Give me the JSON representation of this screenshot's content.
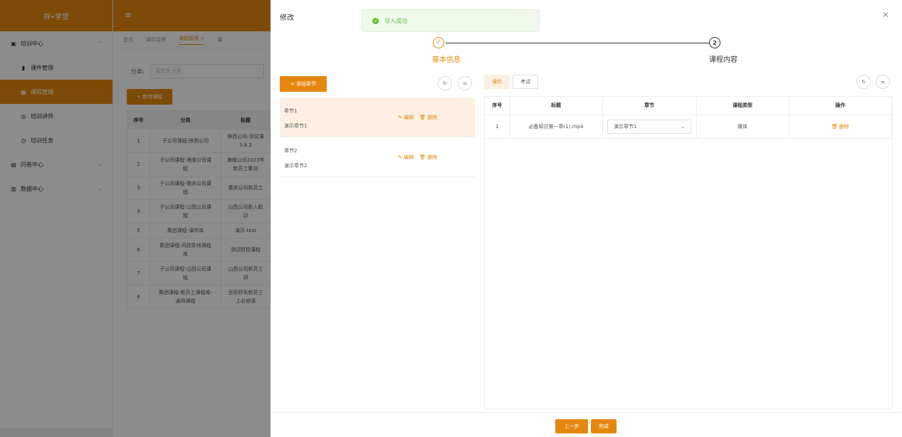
{
  "app": {
    "logo": "祥•学堂",
    "menu_icon": "hamburger-icon"
  },
  "sidebar": {
    "items": [
      {
        "label": "培训中心",
        "icon": "doc-icon",
        "chevron": "⌃"
      },
      {
        "label": "课件管理",
        "icon": "book-icon"
      },
      {
        "label": "课程管理",
        "icon": "grid-icon",
        "active": true
      },
      {
        "label": "培训讲师",
        "icon": "user-icon"
      },
      {
        "label": "培训任务",
        "icon": "clock-icon"
      },
      {
        "label": "问卷中心",
        "icon": "survey-icon",
        "chevron": "⌄"
      },
      {
        "label": "数据中心",
        "icon": "chart-icon",
        "chevron": "⌄"
      }
    ]
  },
  "tabs": [
    "首页",
    "课件管理",
    "课程管理 ×",
    "课"
  ],
  "filter": {
    "label": "分类:",
    "placeholder": "请选择 分类"
  },
  "new_course_button": "+ 新增课程",
  "bg_table": {
    "headers": [
      "序号",
      "分类",
      "标题"
    ],
    "rows": [
      [
        "1",
        "子公司课程-陕西公司",
        "陕西公司-测试课\n3.8.2"
      ],
      [
        "2",
        "子公司课程-海南公司课\n程",
        "海南公司2023年\n新员工集训"
      ],
      [
        "3",
        "子公司课程-重庆公司课\n程",
        "重庆公司新员工"
      ],
      [
        "4",
        "子公司课程-山西公司课\n程",
        "山西公司新入职\n训"
      ],
      [
        "5",
        "集团课程-课件库",
        "演示-test"
      ],
      [
        "6",
        "集团课程-风控条线课程\n库",
        "测试财控课程"
      ],
      [
        "7",
        "子公司课程-山西公司课\n程",
        "山西公司新员工\n训"
      ],
      [
        "8",
        "集团课程-新员工课程库-\n通用课程",
        "豆形好车新员工\n上必修课"
      ]
    ]
  },
  "drawer": {
    "title": "修改",
    "toast": "导入成功",
    "steps": [
      {
        "label": "基本信息",
        "state": "done"
      },
      {
        "label": "课程内容",
        "number": "2",
        "state": "active"
      }
    ],
    "add_chapter_button": "+ 添加章节",
    "chapters": [
      {
        "code": "章节1",
        "name": "演示章节1",
        "edit": "编辑",
        "delete": "删除",
        "selected": true
      },
      {
        "code": "章节2",
        "name": "演示章节2",
        "edit": "编辑",
        "delete": "删除",
        "selected": false
      }
    ],
    "content_tabs": [
      "课件",
      "考试"
    ],
    "content_table": {
      "headers": [
        "序号",
        "标题",
        "章节",
        "课程类型",
        "操作"
      ],
      "rows": [
        {
          "index": "1",
          "title": "必备知识第一章(1).mp4",
          "chapter": "演示章节1",
          "type": "媒体",
          "action": "删除"
        }
      ]
    },
    "footer": {
      "prev": "上一步",
      "done": "完成"
    }
  },
  "colors": {
    "accent": "#e5870e",
    "success": "#67c23a"
  }
}
